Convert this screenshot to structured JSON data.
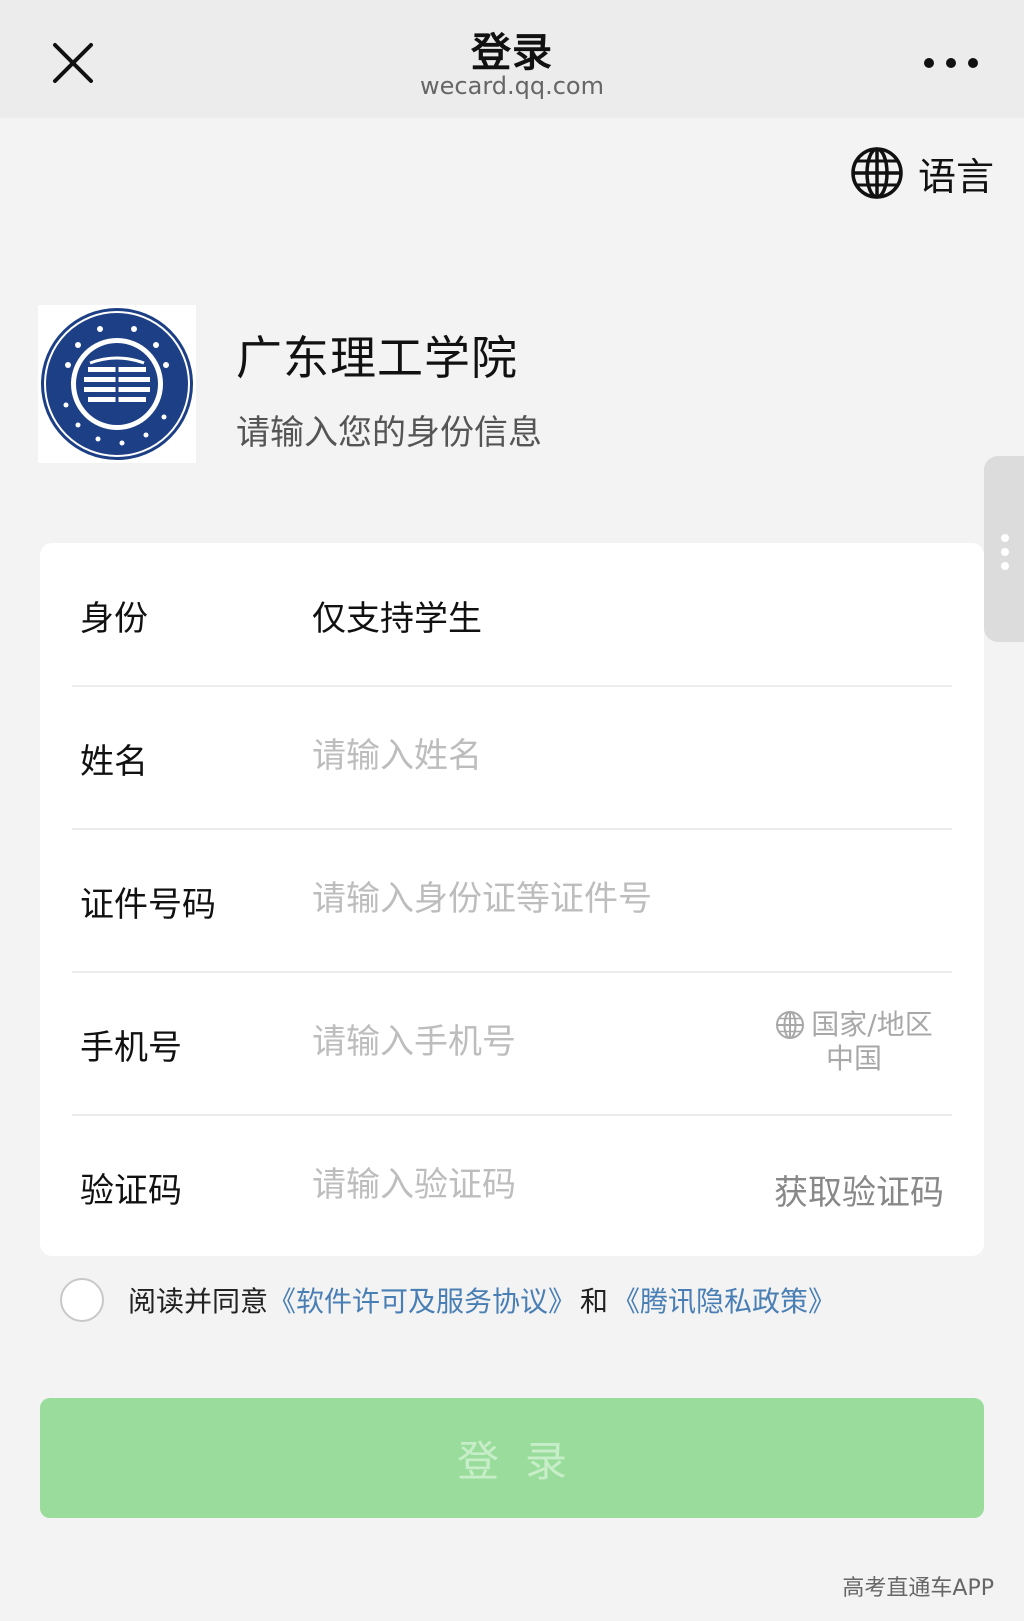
{
  "nav": {
    "title": "登录",
    "url": "wecard.qq.com"
  },
  "language": {
    "label": "语言"
  },
  "school": {
    "name": "广东理工学院",
    "subtitle": "请输入您的身份信息"
  },
  "form": {
    "identity": {
      "label": "身份",
      "value": "仅支持学生"
    },
    "name": {
      "label": "姓名",
      "placeholder": "请输入姓名"
    },
    "id_number": {
      "label": "证件号码",
      "placeholder": "请输入身份证等证件号"
    },
    "phone": {
      "label": "手机号",
      "placeholder": "请输入手机号",
      "region_label": "国家/地区",
      "region_value": "中国"
    },
    "code": {
      "label": "验证码",
      "placeholder": "请输入验证码",
      "get_code": "获取验证码"
    }
  },
  "agreement": {
    "prefix": "阅读并同意",
    "link1": "《软件许可及服务协议》",
    "conj": "和",
    "link2": "《腾讯隐私政策》"
  },
  "login_button": "登录",
  "watermark": "高考直通车APP",
  "colors": {
    "primary_disabled": "#99dc9b",
    "link": "#4a7fb5",
    "logo_blue": "#1d3f86"
  }
}
